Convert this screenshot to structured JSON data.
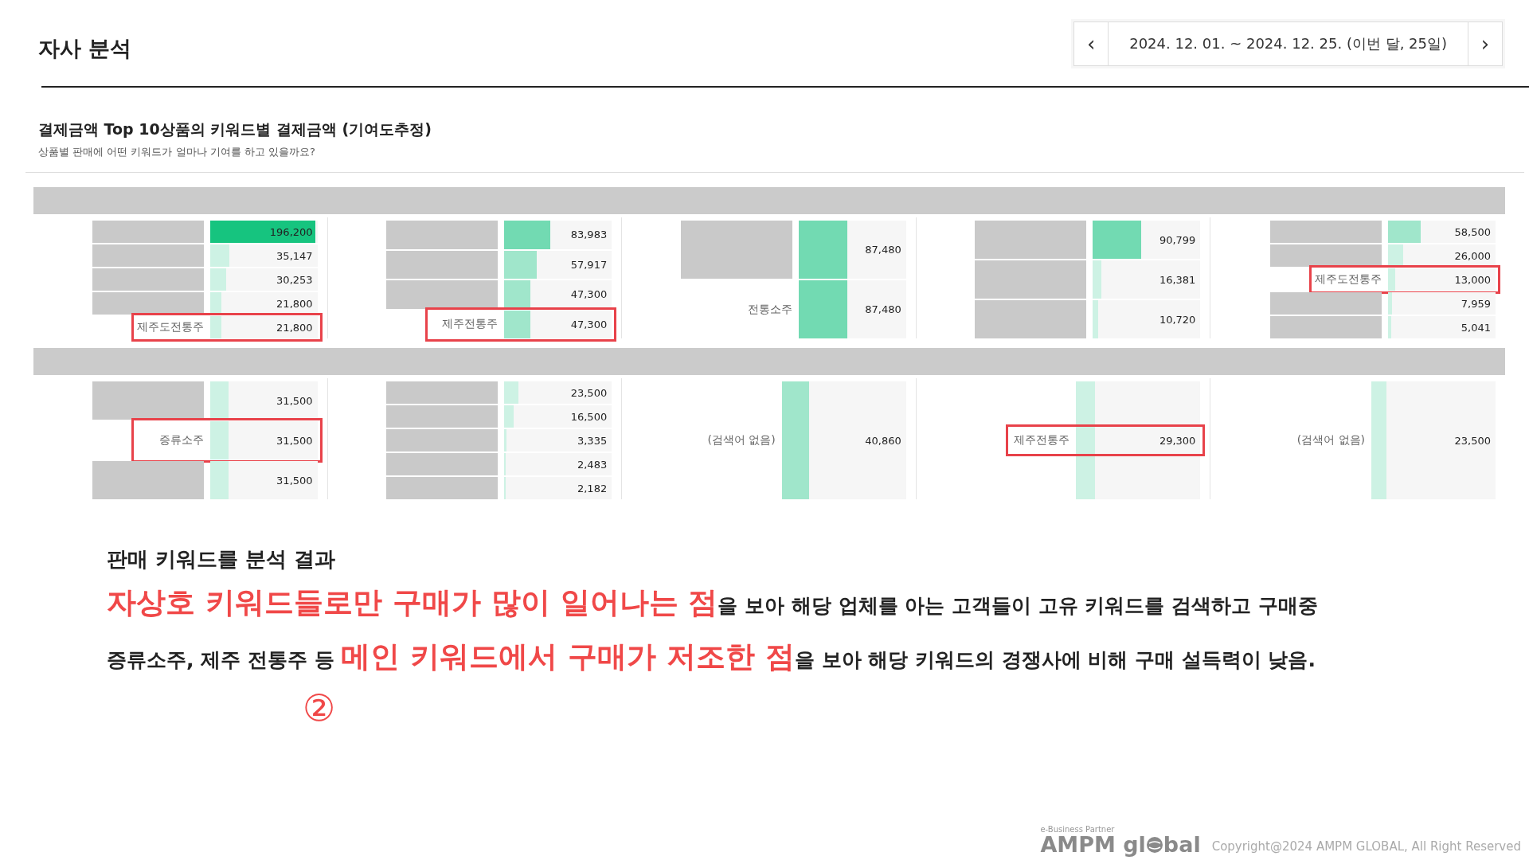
{
  "page_title": "자사 분석",
  "date_range": {
    "prev": "‹",
    "label": "2024. 12. 01. ~ 2024. 12. 25. (이번 달, 25일)",
    "next": "›"
  },
  "section": {
    "title": "결제금액 Top 10상품의 키워드별 결제금액 (기여도추정)",
    "subtitle": "상품별 판매에 어떤 키워드가 얼마나 기여를 하고 있을까요?"
  },
  "product_rows": [
    {
      "cards": [
        {
          "keywords": [
            {
              "redacted": true,
              "value": "196,200",
              "level": 0.98,
              "highlighted": false
            },
            {
              "redacted": true,
              "value": "35,147",
              "level": 0.18,
              "highlighted": false
            },
            {
              "redacted": true,
              "value": "30,253",
              "level": 0.15,
              "highlighted": false
            },
            {
              "redacted": true,
              "value": "21,800",
              "level": 0.11,
              "highlighted": false
            },
            {
              "label": "제주도전통주",
              "value": "21,800",
              "level": 0.11,
              "highlighted": true
            }
          ]
        },
        {
          "keywords": [
            {
              "redacted": true,
              "value": "83,983",
              "level": 0.43,
              "highlighted": false
            },
            {
              "redacted": true,
              "value": "57,917",
              "level": 0.3,
              "highlighted": false
            },
            {
              "redacted": true,
              "value": "47,300",
              "level": 0.24,
              "highlighted": false
            },
            {
              "label": "제주전통주",
              "value": "47,300",
              "level": 0.24,
              "highlighted": true
            }
          ]
        },
        {
          "keywords": [
            {
              "redacted": true,
              "value": "87,480",
              "level": 0.45,
              "highlighted": false
            },
            {
              "label": "전통소주",
              "value": "87,480",
              "level": 0.45,
              "highlighted": false
            }
          ]
        },
        {
          "keywords": [
            {
              "redacted": true,
              "value": "90,799",
              "level": 0.45,
              "highlighted": false
            },
            {
              "redacted": true,
              "value": "16,381",
              "level": 0.08,
              "highlighted": false
            },
            {
              "redacted": true,
              "value": "10,720",
              "level": 0.05,
              "highlighted": false
            }
          ]
        },
        {
          "keywords": [
            {
              "redacted": true,
              "value": "58,500",
              "level": 0.3,
              "highlighted": false
            },
            {
              "redacted": true,
              "value": "26,000",
              "level": 0.14,
              "highlighted": false
            },
            {
              "label": "제주도전통주",
              "value": "13,000",
              "level": 0.07,
              "highlighted": true
            },
            {
              "redacted": true,
              "value": "7,959",
              "level": 0.04,
              "highlighted": false
            },
            {
              "redacted": true,
              "value": "5,041",
              "level": 0.03,
              "highlighted": false
            }
          ]
        }
      ]
    },
    {
      "cards": [
        {
          "keywords": [
            {
              "redacted": true,
              "value": "31,500",
              "level": 0.17,
              "highlighted": false
            },
            {
              "label": "증류소주",
              "value": "31,500",
              "level": 0.17,
              "highlighted": true
            },
            {
              "redacted": true,
              "value": "31,500",
              "level": 0.17,
              "highlighted": false
            }
          ]
        },
        {
          "keywords": [
            {
              "redacted": true,
              "value": "23,500",
              "level": 0.13,
              "highlighted": false
            },
            {
              "redacted": true,
              "value": "16,500",
              "level": 0.09,
              "highlighted": false
            },
            {
              "redacted": true,
              "value": "3,335",
              "level": 0.02,
              "highlighted": false
            },
            {
              "redacted": true,
              "value": "2,483",
              "level": 0.01,
              "highlighted": false
            },
            {
              "redacted": true,
              "value": "2,182",
              "level": 0.01,
              "highlighted": false
            }
          ]
        },
        {
          "keywords": [
            {
              "label": "(검색어 없음)",
              "value": "40,860",
              "level": 0.22,
              "highlighted": false
            }
          ]
        },
        {
          "keywords": [
            {
              "label": "제주전통주",
              "value": "29,300",
              "level": 0.15,
              "highlighted": true
            }
          ]
        },
        {
          "keywords": [
            {
              "label": "(검색어 없음)",
              "value": "23,500",
              "level": 0.12,
              "highlighted": false
            }
          ]
        }
      ]
    }
  ],
  "analysis": {
    "heading": "판매 키워드를 분석 결과",
    "lines": [
      [
        {
          "text": "자상호 키워드들로만 구매가 많이 일어나는 점",
          "emphasis": true
        },
        {
          "text": "을 보아 해당 업체를 아는 고객들이 고유 키워드를 검색하고  구매중",
          "emphasis": false
        }
      ],
      [
        {
          "text": "증류소주, 제주 전통주 등 ",
          "emphasis": false
        },
        {
          "text": "메인 키워드에서 구매가 저조한 점",
          "emphasis": true
        },
        {
          "text": "을 보아 해당 키워드의 경쟁사에 비해 구매 설득력이 낮음.",
          "emphasis": false
        }
      ]
    ],
    "marker": "②"
  },
  "footer": {
    "partner": "e-Business Partner",
    "logo_left": "AMPM gl",
    "logo_right": "bal",
    "copyright": "Copyright@2024 AMPM GLOBAL, All Right Reserved"
  }
}
